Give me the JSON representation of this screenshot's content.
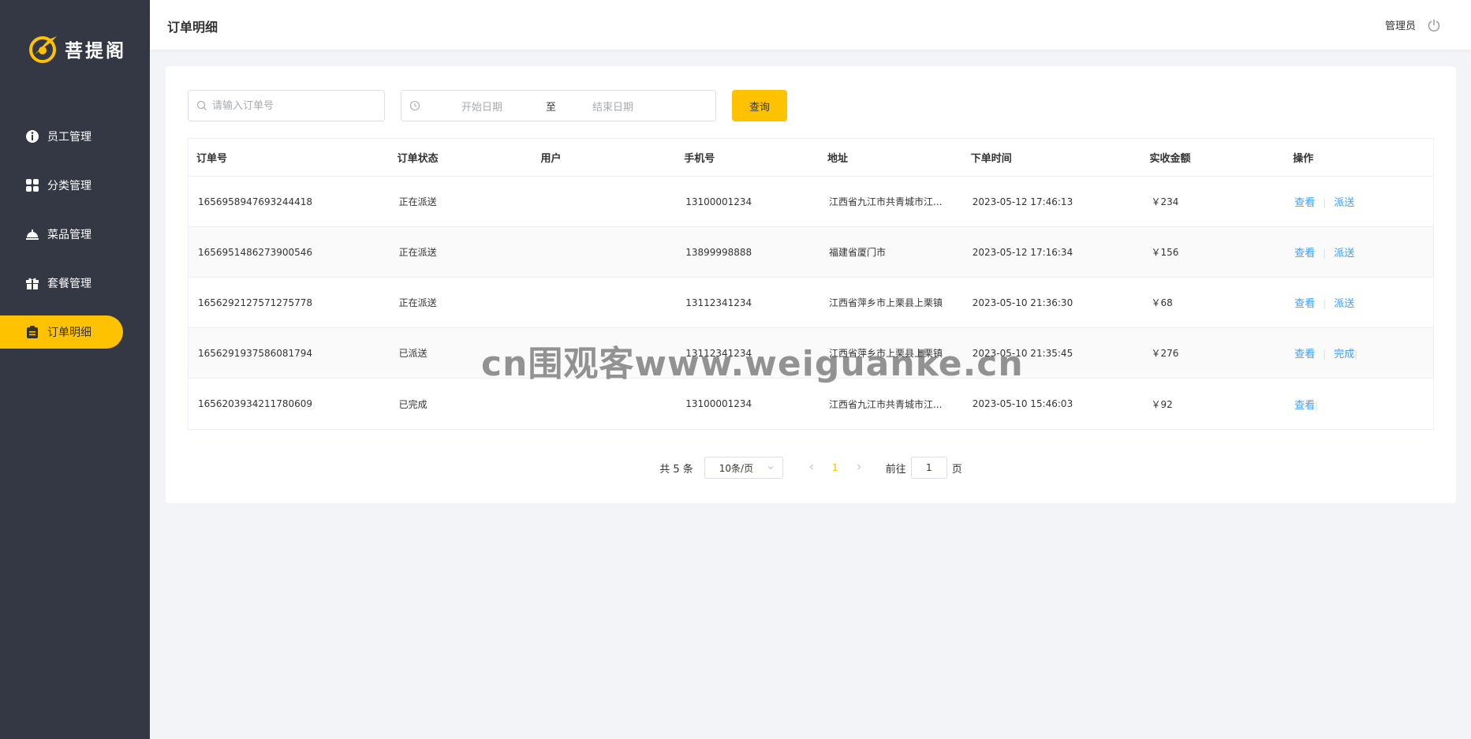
{
  "brand": {
    "name": "菩提阁",
    "accent": "#ffc200"
  },
  "sidebar": {
    "items": [
      {
        "label": "员工管理",
        "icon": "employee-icon",
        "active": false
      },
      {
        "label": "分类管理",
        "icon": "category-icon",
        "active": false
      },
      {
        "label": "菜品管理",
        "icon": "dish-icon",
        "active": false
      },
      {
        "label": "套餐管理",
        "icon": "gift-icon",
        "active": false
      },
      {
        "label": "订单明细",
        "icon": "clipboard-icon",
        "active": true
      }
    ]
  },
  "header": {
    "title": "订单明细",
    "user": "管理员"
  },
  "filters": {
    "order_placeholder": "请输入订单号",
    "start_placeholder": "开始日期",
    "separator": "至",
    "end_placeholder": "结束日期",
    "query_label": "查询"
  },
  "table": {
    "columns": [
      "订单号",
      "订单状态",
      "用户",
      "手机号",
      "地址",
      "下单时间",
      "实收金额",
      "操作"
    ],
    "rows": [
      {
        "order_no": "1656958947693244418",
        "status": "正在派送",
        "user": "",
        "phone": "13100001234",
        "address": "江西省九江市共青城市江...",
        "time": "2023-05-12 17:46:13",
        "amount": "￥234",
        "view": "查看",
        "action": "派送"
      },
      {
        "order_no": "1656951486273900546",
        "status": "正在派送",
        "user": "",
        "phone": "13899998888",
        "address": "福建省厦门市",
        "time": "2023-05-12 17:16:34",
        "amount": "￥156",
        "view": "查看",
        "action": "派送"
      },
      {
        "order_no": "1656292127571275778",
        "status": "正在派送",
        "user": "",
        "phone": "13112341234",
        "address": "江西省萍乡市上栗县上栗镇",
        "time": "2023-05-10 21:36:30",
        "amount": "￥68",
        "view": "查看",
        "action": "派送"
      },
      {
        "order_no": "1656291937586081794",
        "status": "已派送",
        "user": "",
        "phone": "13112341234",
        "address": "江西省萍乡市上栗县上栗镇",
        "time": "2023-05-10 21:35:45",
        "amount": "￥276",
        "view": "查看",
        "action": "完成"
      },
      {
        "order_no": "1656203934211780609",
        "status": "已完成",
        "user": "",
        "phone": "13100001234",
        "address": "江西省九江市共青城市江...",
        "time": "2023-05-10 15:46:03",
        "amount": "￥92",
        "view": "查看",
        "action": ""
      }
    ]
  },
  "pagination": {
    "total_text": "共 5 条",
    "page_size": "10条/页",
    "current_page": "1",
    "goto_label": "前往",
    "goto_value": "1",
    "page_suffix": "页"
  },
  "watermark": "cn围观客www.weiguanke.cn"
}
